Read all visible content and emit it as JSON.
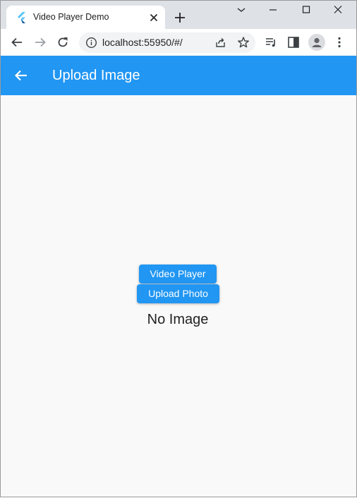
{
  "browser": {
    "tab_title": "Video Player Demo",
    "url": "localhost:55950/#/"
  },
  "icons": {
    "tab_favicon": "flutter-logo-icon",
    "tab_close": "close-icon",
    "new_tab": "plus-icon",
    "minimize": "minimize-icon",
    "maximize": "maximize-icon",
    "close_window": "close-icon",
    "back": "arrow-left-icon",
    "forward": "arrow-right-icon",
    "reload": "reload-icon",
    "site_info": "info-icon",
    "share": "share-icon",
    "bookmark": "star-icon",
    "reading_list": "reading-list-icon",
    "side_panel": "side-panel-icon",
    "profile": "person-icon",
    "menu": "kebab-menu-icon",
    "app_back": "arrow-left-icon"
  },
  "colors": {
    "appbar": "#2196f3",
    "button": "#2196f3",
    "background": "#f9f9f9"
  },
  "appbar": {
    "title": "Upload Image"
  },
  "main": {
    "video_button_label": "Video Player",
    "upload_button_label": "Upload Photo",
    "status_text": "No Image"
  }
}
